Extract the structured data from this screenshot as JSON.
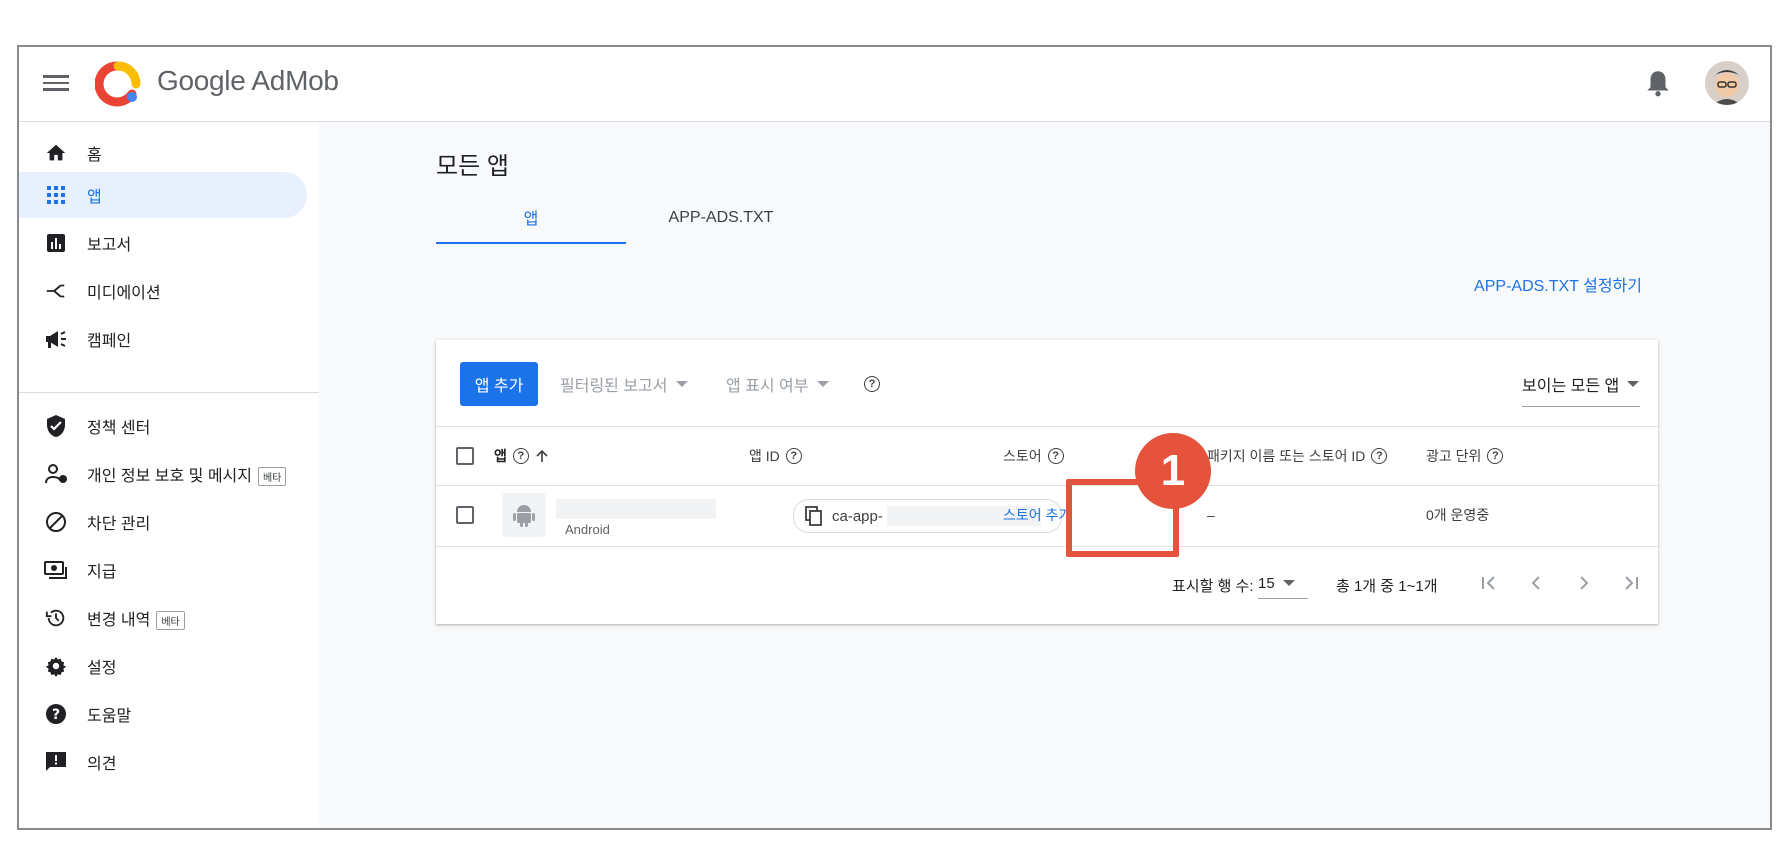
{
  "app": {
    "brand_name": "Google AdMob"
  },
  "sidebar": {
    "items": [
      {
        "label": "홈",
        "icon": "home-icon"
      },
      {
        "label": "앱",
        "icon": "apps-grid-icon",
        "active": true
      },
      {
        "label": "보고서",
        "icon": "report-chart-icon"
      },
      {
        "label": "미디에이션",
        "icon": "mediation-icon"
      },
      {
        "label": "캠페인",
        "icon": "campaign-megaphone-icon"
      },
      {
        "label": "정책 센터",
        "icon": "policy-shield-icon"
      },
      {
        "label": "개인 정보 보호 및 메시지",
        "badge": "베타",
        "icon": "privacy-person-icon"
      },
      {
        "label": "차단 관리",
        "icon": "block-icon"
      },
      {
        "label": "지급",
        "icon": "payments-icon"
      },
      {
        "label": "변경 내역",
        "badge": "베타",
        "icon": "history-icon"
      },
      {
        "label": "설정",
        "icon": "settings-gear-icon"
      },
      {
        "label": "도움말",
        "icon": "help-icon"
      },
      {
        "label": "의견",
        "icon": "feedback-icon"
      }
    ]
  },
  "main": {
    "title": "모든 앱",
    "tabs": [
      {
        "label": "앱",
        "active": true
      },
      {
        "label": "APP-ADS.TXT",
        "active": false
      }
    ],
    "setup_link": "APP-ADS.TXT 설정하기"
  },
  "toolbar": {
    "add_app_label": "앱 추가",
    "filtered_reports_label": "필터링된 보고서",
    "app_visibility_label": "앱 표시 여부",
    "help_glyph": "?",
    "view_select_value": "보이는 모든 앱"
  },
  "table": {
    "columns": [
      {
        "label": "앱",
        "sort": "ascending"
      },
      {
        "label": "앱 ID"
      },
      {
        "label": "스토어"
      },
      {
        "label": "패키지 이름 또는 스토어 ID"
      },
      {
        "label": "광고 단위"
      }
    ],
    "rows": [
      {
        "app_platform": "Android",
        "app_id_prefix": "ca-app-",
        "store_action": "스토어 추가",
        "package": "–",
        "ad_units": "0개 운영중"
      }
    ]
  },
  "pagination": {
    "rows_per_page_label": "표시할 행 수:",
    "rows_per_page_value": "15",
    "range_text": "총 1개 중 1~1개"
  },
  "annotation": {
    "step_number": "1"
  },
  "colors": {
    "primary": "#1a73e8",
    "annotation": "#e5533c",
    "nav_active_bg": "#e8f0fe"
  }
}
